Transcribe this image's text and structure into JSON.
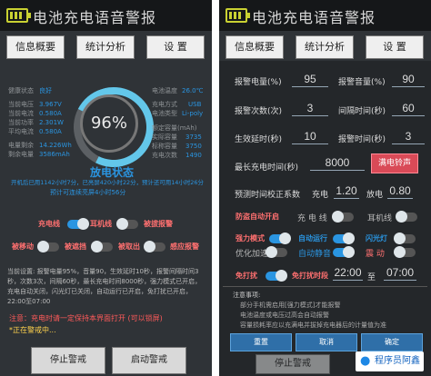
{
  "colors": {
    "accent": "#2a95e1",
    "warning": "#ff7070",
    "panel": "#2f3337",
    "header": "#151719",
    "button": "#d94a57"
  },
  "left": {
    "title": "电池充电语音警报",
    "tabs": [
      "信息概要",
      "统计分析",
      "设  置"
    ],
    "stats_left": [
      {
        "label": "健康状态",
        "value": "良好"
      },
      {
        "label": "当前电压",
        "value": "3.967V"
      },
      {
        "label": "当前电流",
        "value": "0.580A"
      },
      {
        "label": "当前功率",
        "value": "2.301W"
      },
      {
        "label": "平均电流",
        "value": "0.580A"
      },
      {
        "label": "电量剩余",
        "value": "14.226Wh"
      },
      {
        "label": "剩余电量",
        "value": "3586mAh"
      }
    ],
    "stats_right": [
      {
        "label": "电池温度",
        "value": "26.0℃"
      },
      {
        "label": "充电方式",
        "value": "USB"
      },
      {
        "label": "电池类型",
        "value": "Li-poly"
      },
      {
        "label": "额定容量(mAh)",
        "value": ""
      },
      {
        "label": "实际容量",
        "value": "3735"
      },
      {
        "label": "标称容量",
        "value": "3750"
      },
      {
        "label": "充电次数",
        "value": "1490"
      }
    ],
    "gauge_percent": "96%",
    "discharge_title": "放电状态",
    "discharge_lines": [
      "开机后已用1142小时7分，已亮屏420小时22分，预计还可用14小时26分",
      "预计可连续亮屏4小时56分"
    ],
    "controls": [
      {
        "label": "充电线",
        "on": true
      },
      {
        "label": "耳机线",
        "on": false
      },
      {
        "label": "被拔报警",
        "on": false
      },
      {
        "label": "被移动",
        "on": false
      },
      {
        "label": "被遮挡",
        "on": false
      },
      {
        "label": "被取出",
        "on": false
      },
      {
        "label": "感应报警",
        "on": false
      }
    ],
    "settings_text": "当前设置: 报警电量95%，音量90，生效延时10秒，报警间隔时间3秒，次数3次，间隔60秒，最长充电时间8000秒，强力模式已开启，充电自动关闭，闪光灯已关闭，自动运行已开启，免打扰已开启，22:00至07:00",
    "notice_text": "注意：充电时请一定保持本界面打开 (可以锁屏)",
    "alarm_text": "*正在警戒中...",
    "stop_button": "停止警戒",
    "start_button": "启动警戒"
  },
  "right": {
    "title": "电池充电语音警报",
    "tabs": [
      "信息概要",
      "统计分析",
      "设  置"
    ],
    "fields": [
      {
        "label": "报警电量(%)",
        "value": "95",
        "label2": "报警音量(%)",
        "value2": "90"
      },
      {
        "label": "报警次数(次)",
        "value": "3",
        "label2": "间隔时间(秒)",
        "value2": "60"
      },
      {
        "label": "生效延时(秒)",
        "value": "10",
        "label2": "报警时间(秒)",
        "value2": "3"
      }
    ],
    "max_charge_label": "最长充电时间(秒)",
    "max_charge_value": "8000",
    "full_alarm_button": "满电铃声",
    "time_factor_label": "预测时间校正系数",
    "charge_label": "充电",
    "charge_value": "1.20",
    "discharge_label": "放电",
    "discharge_value": "0.80",
    "toggles": [
      {
        "label": "防盗自动开启",
        "on": false
      },
      {
        "label": "充 电 线",
        "on": false
      },
      {
        "label": "耳机线",
        "on": false
      },
      {
        "label": "强力模式",
        "on": true
      },
      {
        "label": "自动运行",
        "on": true
      },
      {
        "label": "闪光灯",
        "on": false
      },
      {
        "label": "优化加速",
        "on": false
      },
      {
        "label": "自动静音",
        "on": true
      },
      {
        "label": "震  动",
        "on": false
      }
    ],
    "dnd": {
      "label": "免打扰",
      "period_label": "免打扰时段",
      "start": "22:00",
      "to": "至",
      "end": "07:00"
    },
    "notes": [
      "注意事项:",
      "部分手机需启用[强力模式]才能报警",
      "电池温度或电压过高会自动报警",
      "容量损耗率应以充满电并拔掉充电器后的计量值为准"
    ],
    "dialog_buttons": [
      "重置",
      "取消",
      "确定"
    ],
    "bottom_hidden": "停止警戒",
    "watermark": "程序员阿鑫"
  }
}
